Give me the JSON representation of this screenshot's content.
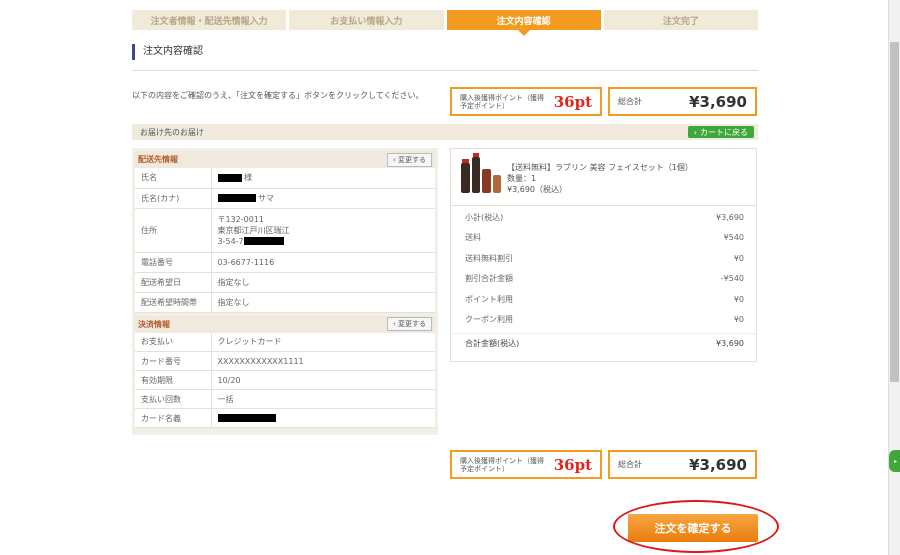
{
  "steps": [
    "注文者情報・配送先情報入力",
    "お支払い情報入力",
    "注文内容確認",
    "注文完了"
  ],
  "page_title": "注文内容確認",
  "instruction": "以下の内容をご確認のうえ、「注文を確定する」ボタンをクリックしてください。",
  "points": {
    "label": "購入後獲得ポイント（獲得予定ポイント）",
    "value": "36pt"
  },
  "total": {
    "label": "総合計",
    "value": "¥3,690"
  },
  "delivery_band": "お届け先のお届け",
  "cart_button": "カートに戻る",
  "shipping": {
    "title": "配送先情報",
    "edit": "変更する",
    "rows": [
      {
        "k": "氏名",
        "v": "様"
      },
      {
        "k": "氏名(カナ)",
        "v": "サマ"
      },
      {
        "k": "住所",
        "v1": "〒132-0011",
        "v2": "東京都江戸川区瑞江",
        "v3": "3-54-7"
      },
      {
        "k": "電話番号",
        "v": "03-6677-1116"
      },
      {
        "k": "配送希望日",
        "v": "指定なし"
      },
      {
        "k": "配送希望時間帯",
        "v": "指定なし"
      }
    ]
  },
  "payment": {
    "title": "決済情報",
    "edit": "変更する",
    "rows": [
      {
        "k": "お支払い",
        "v": "クレジットカード"
      },
      {
        "k": "カード番号",
        "v": "XXXXXXXXXXXX1111"
      },
      {
        "k": "有効期限",
        "v": "10/20"
      },
      {
        "k": "支払い回数",
        "v": "一括"
      },
      {
        "k": "カード名義",
        "v": ""
      }
    ]
  },
  "product": {
    "name": "【送料無料】ラブリン 美容 フェイスセット（1個）",
    "qty": "数量：1",
    "price": "¥3,690（税込）"
  },
  "summary": [
    {
      "k": "小計(税込)",
      "v": "¥3,690"
    },
    {
      "k": "送料",
      "v": "¥540"
    },
    {
      "k": "送料無料割引",
      "v": "¥0"
    },
    {
      "k": "割引合計金額",
      "v": "-¥540"
    },
    {
      "k": "ポイント利用",
      "v": "¥0"
    },
    {
      "k": "クーポン利用",
      "v": "¥0"
    },
    {
      "k": "合計金額(税込)",
      "v": "¥3,690"
    }
  ],
  "confirm_button": "注文を確定する",
  "colors": {
    "accent": "#f39b1f",
    "points_red": "#e0251c",
    "cart_green": "#3fa83a",
    "oval_red": "#e0161b"
  }
}
